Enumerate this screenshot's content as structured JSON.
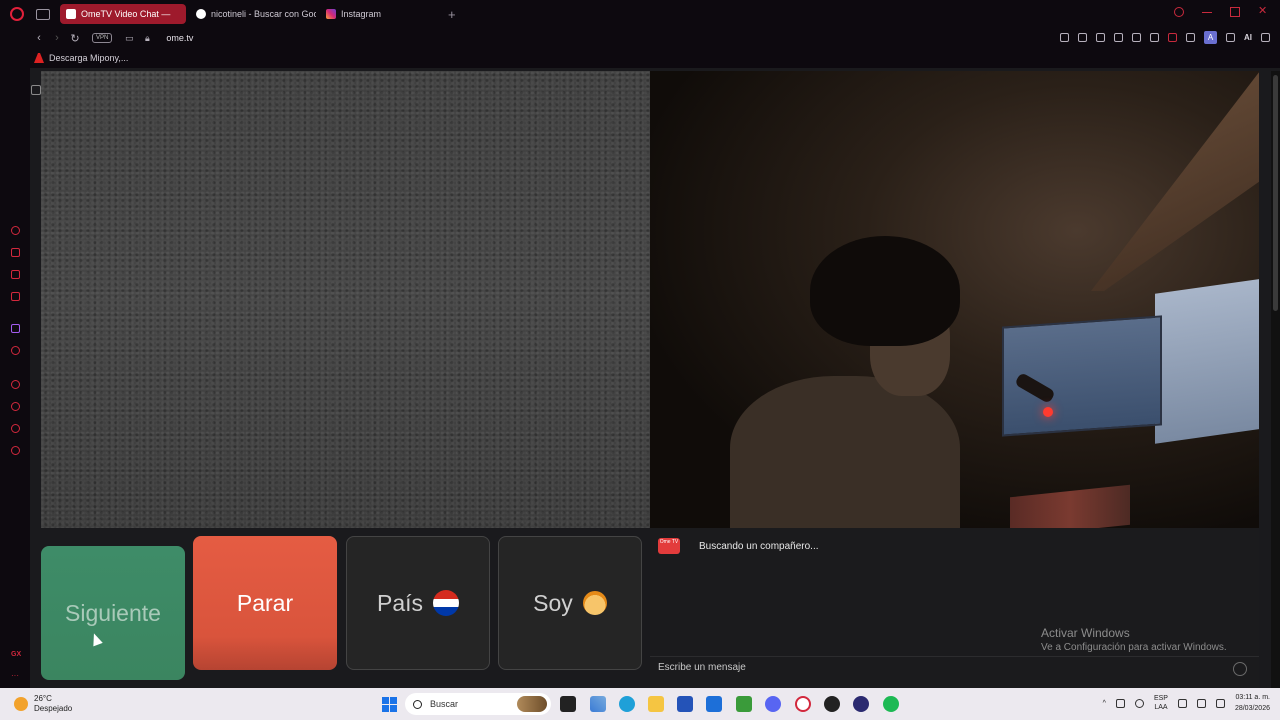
{
  "browser": {
    "tabs": [
      {
        "label": "OmeTV Video Chat — ",
        "active": true
      },
      {
        "label": "nicotineli - Buscar con Goo",
        "active": false
      },
      {
        "label": "Instagram",
        "active": false
      }
    ],
    "new_tab": "+",
    "vpn": "VPN",
    "url": "ome.tv",
    "ai_label": "AI",
    "account_initial": "A",
    "bookmark": "Descarga Mipony,..."
  },
  "sidebar": {
    "gx_label": "GX",
    "more_label": "···"
  },
  "buttons": {
    "next": "Siguiente",
    "stop": "Parar",
    "country": "País",
    "soy": "Soy"
  },
  "chat": {
    "logo_text": "Ome TV",
    "status": "Buscando un compañero...",
    "activate_title": "Activar Windows",
    "activate_sub": "Ve a Configuración para activar Windows.",
    "placeholder": "Escribe un mensaje"
  },
  "taskbar": {
    "temperature": "26°C",
    "weather": "Despejado",
    "search_placeholder": "Buscar",
    "lang_1": "ESP",
    "lang_2": "LAA",
    "time": "03:11 a. m.",
    "date": "28/03/2026"
  },
  "colors": {
    "opera_red": "#d2283d",
    "active_tab": "#9e1a2c",
    "next_green": "#3e8c68",
    "stop_orange": "#e55c43"
  }
}
